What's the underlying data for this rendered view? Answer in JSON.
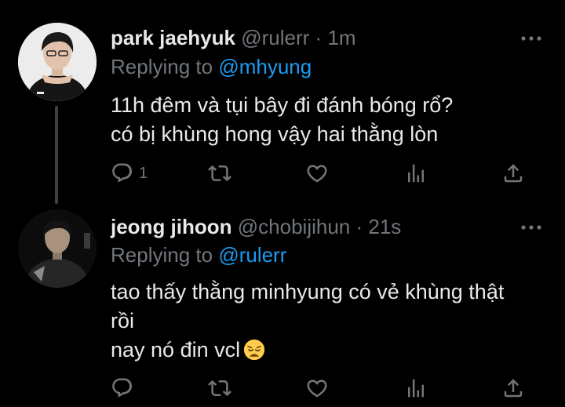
{
  "tweets": [
    {
      "name": "park jaehyuk",
      "handle": "@rulerr",
      "separator": "·",
      "time": "1m",
      "replying_prefix": "Replying to",
      "replying_to": "@mhyung",
      "lines": [
        "11h đêm và tụi bây đi đánh bóng rổ?",
        "có bị khùng hong vậy hai thằng lòn"
      ],
      "reply_count": "1"
    },
    {
      "name": "jeong jihoon",
      "handle": "@chobijihun",
      "separator": "·",
      "time": "21s",
      "replying_prefix": "Replying to",
      "replying_to": "@rulerr",
      "lines": [
        "tao thấy thằng minhyung có vẻ khùng thật",
        "rồi",
        "nay nó đin vcl"
      ],
      "emoji": "weary-face-emoji",
      "reply_count": ""
    }
  ],
  "colors": {
    "background": "#000000",
    "text": "#e7e9ea",
    "muted": "#71767b",
    "accent": "#1d9bf0",
    "thread_line": "#3e4144"
  },
  "icons": [
    "reply-icon",
    "retweet-icon",
    "like-icon",
    "stats-icon",
    "share-icon",
    "more-icon"
  ]
}
